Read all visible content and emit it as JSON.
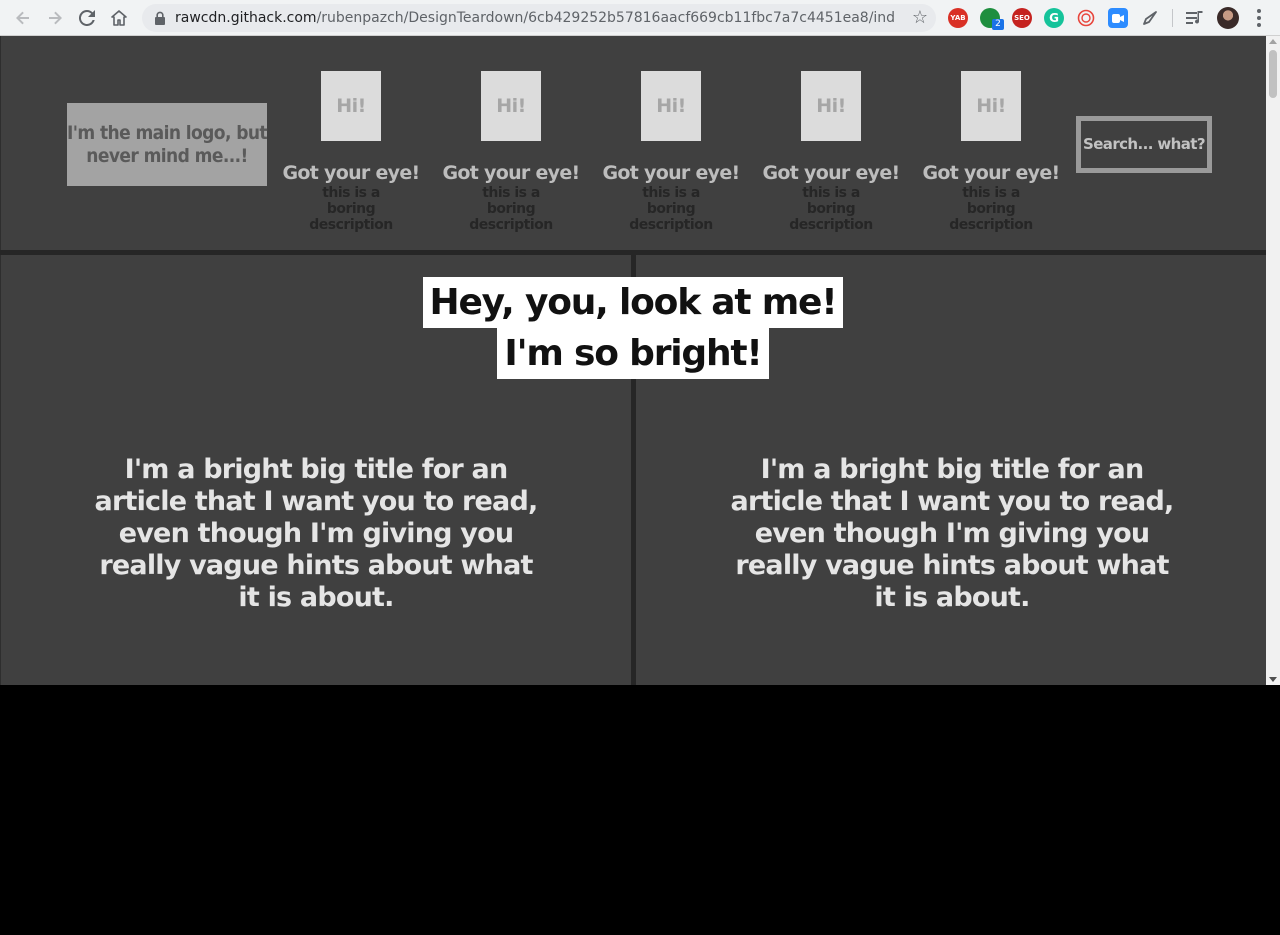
{
  "browser": {
    "url_host": "rawcdn.githack.com",
    "url_path": "/rubenpazch/DesignTeardown/6cb429252b57816aacf669cb11fbc7a7c4451ea8/index....",
    "extensions": [
      {
        "name": "yab-extension-icon",
        "label": "YAB",
        "color": "#d93025"
      },
      {
        "name": "green-extension-icon",
        "label": "",
        "color": "#1e8e3e",
        "badge": "2"
      },
      {
        "name": "seo-extension-icon",
        "label": "SEO",
        "color": "#c5221f"
      },
      {
        "name": "grammarly-icon",
        "label": "G",
        "color": "#15c39a"
      },
      {
        "name": "spiral-extension-icon",
        "label": "",
        "color": "#e8453c"
      },
      {
        "name": "zoom-extension-icon",
        "label": "",
        "color": "#2d8cff"
      },
      {
        "name": "feather-extension-icon",
        "label": "",
        "color": "#5f6368"
      }
    ]
  },
  "header": {
    "logo_text": "I'm the main logo, but never mind me...!",
    "nav_items": [
      {
        "thumb": "Hi!",
        "title": "Got your eye!",
        "description": "this is a boring description"
      },
      {
        "thumb": "Hi!",
        "title": "Got your eye!",
        "description": "this is a boring description"
      },
      {
        "thumb": "Hi!",
        "title": "Got your eye!",
        "description": "this is a boring description"
      },
      {
        "thumb": "Hi!",
        "title": "Got your eye!",
        "description": "this is a boring description"
      },
      {
        "thumb": "Hi!",
        "title": "Got your eye!",
        "description": "this is a boring description"
      }
    ],
    "search_placeholder": "Search... what?"
  },
  "hero": {
    "line1": "Hey, you, look at me!",
    "line2": "I'm so bright!"
  },
  "articles": [
    {
      "title": "I'm a bright big title for an article that I want you to read, even though I'm giving you really vague hints about what it is about."
    },
    {
      "title": "I'm a bright big title for an article that I want you to read, even though I'm giving you really vague hints about what it is about."
    }
  ]
}
